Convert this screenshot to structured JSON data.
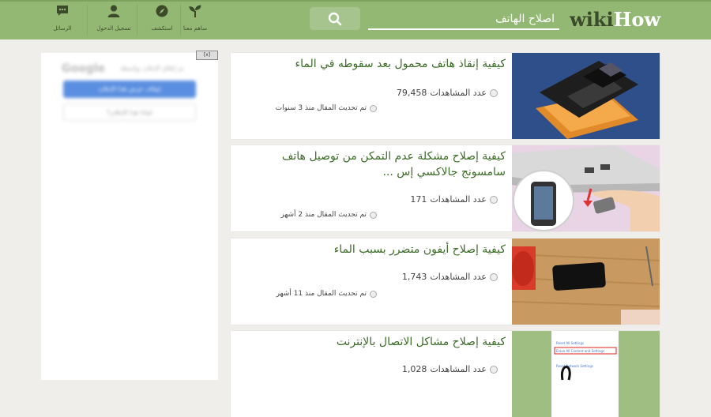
{
  "header": {
    "logo_wiki": "wiki",
    "logo_how": "How",
    "search_value": "اصلاح الهاتف",
    "nav": [
      {
        "label": "الرسائل",
        "icon": "chat-icon"
      },
      {
        "label": "تسجيل الدخول",
        "icon": "user-icon"
      },
      {
        "label": "استكشف",
        "icon": "compass-icon"
      },
      {
        "label": "ساهم معنا",
        "icon": "sprout-icon"
      }
    ]
  },
  "sidebar": {
    "ad_close": "[x]",
    "ad_google": "Google",
    "ad_sub": "تم إغلاق الإعلان بواسطة",
    "ad_btn1": "إيقاف عرض هذا الإعلان",
    "ad_btn2": "لماذا هذا الإعلان؟"
  },
  "articles": [
    {
      "title": "كيفية إنقاذ هاتف محمول بعد سقوطه في الماء",
      "views_label": "عدد المشاهدات",
      "views": "79,458",
      "updated": "تم تحديث المقال منذ 3 سنوات"
    },
    {
      "title": "كيفية إصلاح مشكلة عدم التمكن من توصيل هاتف سامسونج جالاكسي إس ...",
      "views_label": "عدد المشاهدات",
      "views": "171",
      "updated": "تم تحديث المقال منذ 2 أشهر"
    },
    {
      "title": "كيفية إصلاح أيفون متضرر بسبب الماء",
      "views_label": "عدد المشاهدات",
      "views": "1,743",
      "updated": "تم تحديث المقال منذ 11 أشهر"
    },
    {
      "title": "كيفية إصلاح مشاكل الاتصال بالإنترنت",
      "views_label": "عدد المشاهدات",
      "views": "1,028",
      "updated": ""
    }
  ],
  "thumb4_lines": [
    "Reset All Settings",
    "Erase All Content and Settings",
    "Reset Network Settings"
  ],
  "colors": {
    "header": "#93b874",
    "title": "#3c6b28",
    "background": "#efeeeb"
  }
}
